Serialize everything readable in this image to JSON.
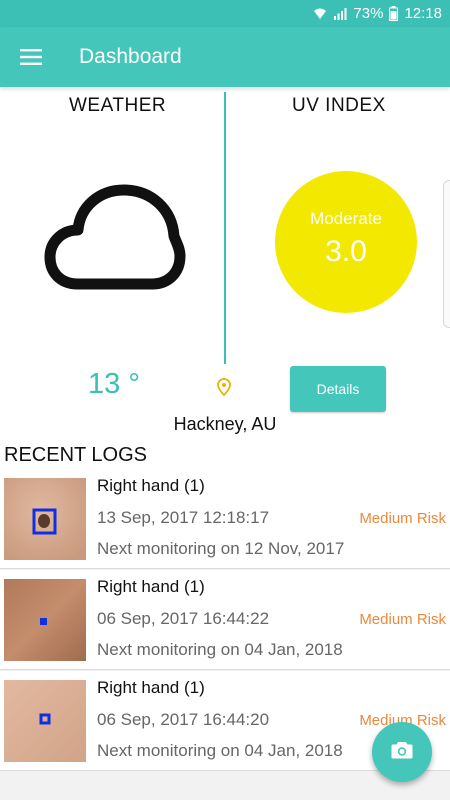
{
  "status_bar": {
    "battery": "73%",
    "time": "12:18",
    "icons": [
      "wifi-icon",
      "signal-icon",
      "battery-icon"
    ]
  },
  "app_bar": {
    "title": "Dashboard",
    "menu_icon": "hamburger-menu-icon"
  },
  "weather": {
    "label": "WEATHER",
    "icon": "cloud-icon",
    "temperature": "13 °"
  },
  "uv_index": {
    "label": "UV INDEX",
    "level": "Moderate",
    "value": "3.0"
  },
  "location": "Hackney, AU",
  "details_button": "Details",
  "recent_logs": {
    "header": "RECENT LOGS",
    "items": [
      {
        "title": "Right hand (1)",
        "date": "13 Sep, 2017 12:18:17",
        "risk": "Medium Risk",
        "next": "Next monitoring on 12 Nov, 2017"
      },
      {
        "title": "Right hand (1)",
        "date": "06 Sep, 2017 16:44:22",
        "risk": "Medium Risk",
        "next": "Next monitoring on 04 Jan, 2018"
      },
      {
        "title": "Right hand (1)",
        "date": "06 Sep, 2017 16:44:20",
        "risk": "Medium Risk",
        "next": "Next monitoring on 04 Jan, 2018"
      }
    ]
  },
  "fab_icon": "camera-icon",
  "colors": {
    "primary": "#44c6bb",
    "uv_yellow": "#f2e800",
    "risk_orange": "#e8893a"
  }
}
